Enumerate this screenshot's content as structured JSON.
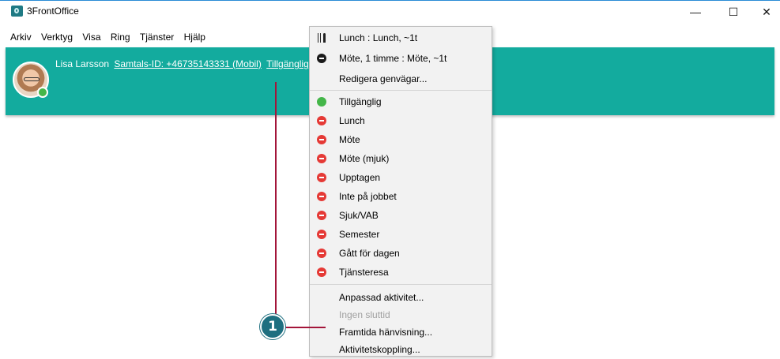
{
  "window": {
    "title": "3FrontOffice",
    "controls": {
      "minimize": "—",
      "maximize": "☐",
      "close": "✕"
    }
  },
  "menubar": [
    "Arkiv",
    "Verktyg",
    "Visa",
    "Ring",
    "Tjänster",
    "Hjälp"
  ],
  "user": {
    "name": "Lisa Larsson",
    "call_id": "Samtals-ID: +46735143331 (Mobil)",
    "status": "Tillgänglig"
  },
  "context_menu": {
    "shortcuts": [
      {
        "label": "Lunch : Lunch, ~1t",
        "icon": "cutlery-icon"
      },
      {
        "label": "Möte, 1 timme : Möte, ~1t",
        "icon": "busy-black-icon"
      },
      {
        "label": "Redigera genvägar..."
      }
    ],
    "statuses": [
      {
        "label": "Tillgänglig",
        "icon": "available-icon",
        "color": "#44b649"
      },
      {
        "label": "Lunch",
        "icon": "busy-icon",
        "color": "#e53935"
      },
      {
        "label": "Möte",
        "icon": "busy-icon",
        "color": "#e53935"
      },
      {
        "label": "Möte (mjuk)",
        "icon": "busy-icon",
        "color": "#e53935"
      },
      {
        "label": "Upptagen",
        "icon": "busy-icon",
        "color": "#e53935"
      },
      {
        "label": "Inte på jobbet",
        "icon": "busy-icon",
        "color": "#e53935"
      },
      {
        "label": "Sjuk/VAB",
        "icon": "busy-icon",
        "color": "#e53935"
      },
      {
        "label": "Semester",
        "icon": "busy-icon",
        "color": "#e53935"
      },
      {
        "label": "Gått för dagen",
        "icon": "busy-icon",
        "color": "#e53935"
      },
      {
        "label": "Tjänsteresa",
        "icon": "busy-icon",
        "color": "#e53935"
      }
    ],
    "actions": [
      {
        "label": "Anpassad aktivitet..."
      },
      {
        "label": "Ingen sluttid",
        "disabled": true
      },
      {
        "label": "Framtida hänvisning..."
      },
      {
        "label": "Aktivitetskoppling..."
      }
    ]
  },
  "callout": {
    "number": "1"
  },
  "colors": {
    "teal_bar": "#13ab9e",
    "callout": "#a3153a",
    "badge": "#1e6f80"
  }
}
